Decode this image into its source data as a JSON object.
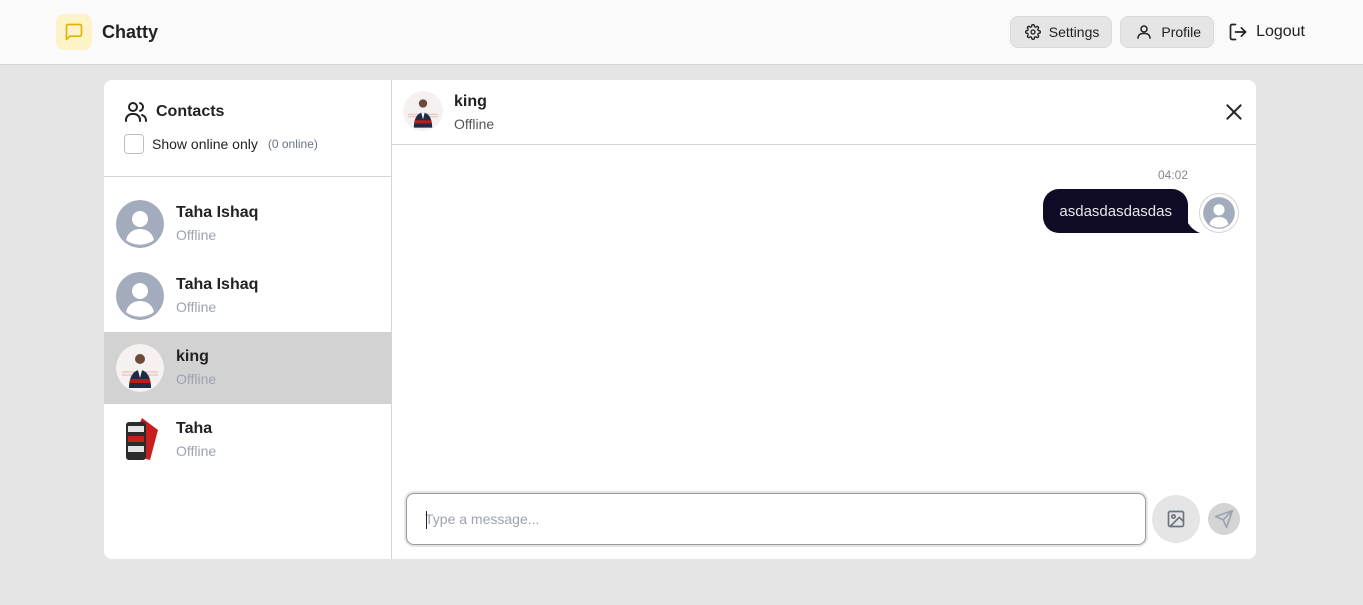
{
  "app": {
    "name": "Chatty",
    "icon": "message-square-icon",
    "accent": "#fcf3c8"
  },
  "nav": {
    "settings_label": "Settings",
    "profile_label": "Profile",
    "logout_label": "Logout"
  },
  "sidebar": {
    "title": "Contacts",
    "show_online_label": "Show online only",
    "online_count": "(0 online)",
    "contacts": [
      {
        "name": "Taha Ishaq",
        "status": "Offline",
        "avatar": "default-avatar"
      },
      {
        "name": "Taha Ishaq",
        "status": "Offline",
        "avatar": "default-avatar"
      },
      {
        "name": "king",
        "status": "Offline",
        "avatar": "photo-avatar",
        "selected": true
      },
      {
        "name": "Taha",
        "status": "Offline",
        "avatar": "photo-avatar"
      }
    ]
  },
  "chat": {
    "name": "king",
    "status": "Offline",
    "messages": [
      {
        "time": "04:02",
        "text": "asdasdasdasdas",
        "own": true
      }
    ],
    "composer": {
      "placeholder": "Type a message...",
      "value": ""
    },
    "bubble_color": "#0f0a26"
  }
}
